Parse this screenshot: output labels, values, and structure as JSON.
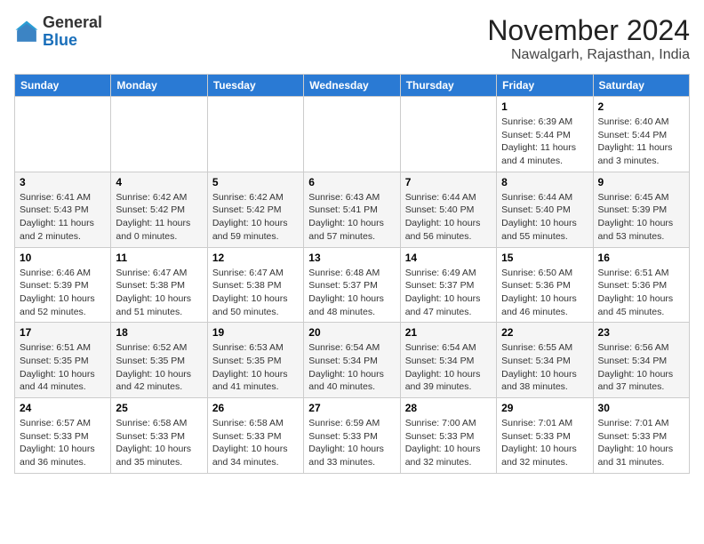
{
  "header": {
    "title": "November 2024",
    "subtitle": "Nawalgarh, Rajasthan, India",
    "logo_line1": "General",
    "logo_line2": "Blue"
  },
  "weekdays": [
    "Sunday",
    "Monday",
    "Tuesday",
    "Wednesday",
    "Thursday",
    "Friday",
    "Saturday"
  ],
  "weeks": [
    [
      {
        "day": "",
        "info": ""
      },
      {
        "day": "",
        "info": ""
      },
      {
        "day": "",
        "info": ""
      },
      {
        "day": "",
        "info": ""
      },
      {
        "day": "",
        "info": ""
      },
      {
        "day": "1",
        "info": "Sunrise: 6:39 AM\nSunset: 5:44 PM\nDaylight: 11 hours and 4 minutes."
      },
      {
        "day": "2",
        "info": "Sunrise: 6:40 AM\nSunset: 5:44 PM\nDaylight: 11 hours and 3 minutes."
      }
    ],
    [
      {
        "day": "3",
        "info": "Sunrise: 6:41 AM\nSunset: 5:43 PM\nDaylight: 11 hours and 2 minutes."
      },
      {
        "day": "4",
        "info": "Sunrise: 6:42 AM\nSunset: 5:42 PM\nDaylight: 11 hours and 0 minutes."
      },
      {
        "day": "5",
        "info": "Sunrise: 6:42 AM\nSunset: 5:42 PM\nDaylight: 10 hours and 59 minutes."
      },
      {
        "day": "6",
        "info": "Sunrise: 6:43 AM\nSunset: 5:41 PM\nDaylight: 10 hours and 57 minutes."
      },
      {
        "day": "7",
        "info": "Sunrise: 6:44 AM\nSunset: 5:40 PM\nDaylight: 10 hours and 56 minutes."
      },
      {
        "day": "8",
        "info": "Sunrise: 6:44 AM\nSunset: 5:40 PM\nDaylight: 10 hours and 55 minutes."
      },
      {
        "day": "9",
        "info": "Sunrise: 6:45 AM\nSunset: 5:39 PM\nDaylight: 10 hours and 53 minutes."
      }
    ],
    [
      {
        "day": "10",
        "info": "Sunrise: 6:46 AM\nSunset: 5:39 PM\nDaylight: 10 hours and 52 minutes."
      },
      {
        "day": "11",
        "info": "Sunrise: 6:47 AM\nSunset: 5:38 PM\nDaylight: 10 hours and 51 minutes."
      },
      {
        "day": "12",
        "info": "Sunrise: 6:47 AM\nSunset: 5:38 PM\nDaylight: 10 hours and 50 minutes."
      },
      {
        "day": "13",
        "info": "Sunrise: 6:48 AM\nSunset: 5:37 PM\nDaylight: 10 hours and 48 minutes."
      },
      {
        "day": "14",
        "info": "Sunrise: 6:49 AM\nSunset: 5:37 PM\nDaylight: 10 hours and 47 minutes."
      },
      {
        "day": "15",
        "info": "Sunrise: 6:50 AM\nSunset: 5:36 PM\nDaylight: 10 hours and 46 minutes."
      },
      {
        "day": "16",
        "info": "Sunrise: 6:51 AM\nSunset: 5:36 PM\nDaylight: 10 hours and 45 minutes."
      }
    ],
    [
      {
        "day": "17",
        "info": "Sunrise: 6:51 AM\nSunset: 5:35 PM\nDaylight: 10 hours and 44 minutes."
      },
      {
        "day": "18",
        "info": "Sunrise: 6:52 AM\nSunset: 5:35 PM\nDaylight: 10 hours and 42 minutes."
      },
      {
        "day": "19",
        "info": "Sunrise: 6:53 AM\nSunset: 5:35 PM\nDaylight: 10 hours and 41 minutes."
      },
      {
        "day": "20",
        "info": "Sunrise: 6:54 AM\nSunset: 5:34 PM\nDaylight: 10 hours and 40 minutes."
      },
      {
        "day": "21",
        "info": "Sunrise: 6:54 AM\nSunset: 5:34 PM\nDaylight: 10 hours and 39 minutes."
      },
      {
        "day": "22",
        "info": "Sunrise: 6:55 AM\nSunset: 5:34 PM\nDaylight: 10 hours and 38 minutes."
      },
      {
        "day": "23",
        "info": "Sunrise: 6:56 AM\nSunset: 5:34 PM\nDaylight: 10 hours and 37 minutes."
      }
    ],
    [
      {
        "day": "24",
        "info": "Sunrise: 6:57 AM\nSunset: 5:33 PM\nDaylight: 10 hours and 36 minutes."
      },
      {
        "day": "25",
        "info": "Sunrise: 6:58 AM\nSunset: 5:33 PM\nDaylight: 10 hours and 35 minutes."
      },
      {
        "day": "26",
        "info": "Sunrise: 6:58 AM\nSunset: 5:33 PM\nDaylight: 10 hours and 34 minutes."
      },
      {
        "day": "27",
        "info": "Sunrise: 6:59 AM\nSunset: 5:33 PM\nDaylight: 10 hours and 33 minutes."
      },
      {
        "day": "28",
        "info": "Sunrise: 7:00 AM\nSunset: 5:33 PM\nDaylight: 10 hours and 32 minutes."
      },
      {
        "day": "29",
        "info": "Sunrise: 7:01 AM\nSunset: 5:33 PM\nDaylight: 10 hours and 32 minutes."
      },
      {
        "day": "30",
        "info": "Sunrise: 7:01 AM\nSunset: 5:33 PM\nDaylight: 10 hours and 31 minutes."
      }
    ]
  ]
}
